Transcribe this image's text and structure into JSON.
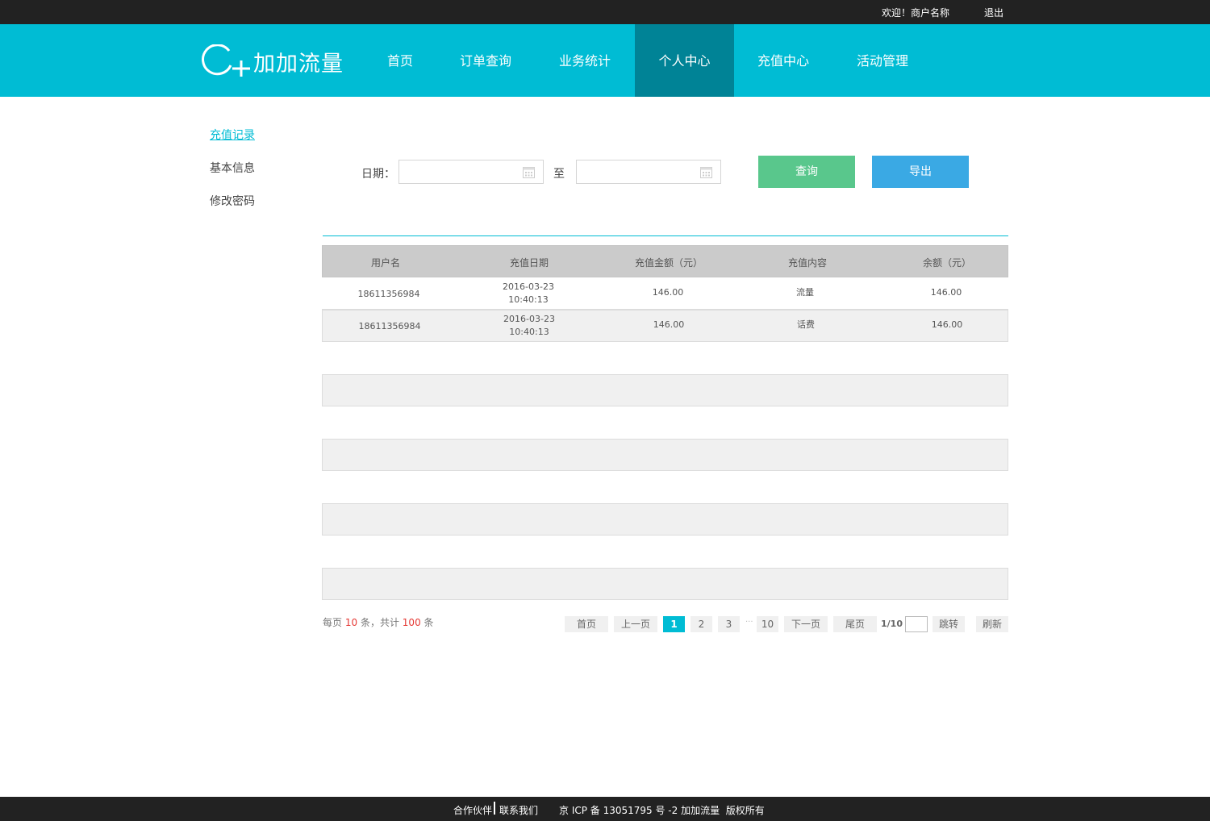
{
  "topbar": {
    "welcome": "欢迎！商户名称",
    "logout": "退出"
  },
  "header": {
    "logo_text": "加加流量",
    "nav": [
      {
        "label": "首页",
        "active": false
      },
      {
        "label": "订单查询",
        "active": false
      },
      {
        "label": "业务统计",
        "active": false
      },
      {
        "label": "个人中心",
        "active": true
      },
      {
        "label": "充值中心",
        "active": false
      },
      {
        "label": "活动管理",
        "active": false
      }
    ]
  },
  "sidebar": {
    "items": [
      {
        "label": "充值记录",
        "active": true
      },
      {
        "label": "基本信息",
        "active": false
      },
      {
        "label": "修改密码",
        "active": false
      }
    ]
  },
  "filter": {
    "date_label": "日期：",
    "to_label": "至",
    "start_value": "",
    "end_value": "",
    "query_button": "查询",
    "export_button": "导出"
  },
  "table": {
    "headers": [
      "用户名",
      "充值日期",
      "充值金额（元）",
      "充值内容",
      "余额（元）"
    ],
    "rows": [
      {
        "user": "18611356984",
        "date": "2016-03-23",
        "time": "10:40:13",
        "amount": "146.00",
        "content": "流量",
        "balance": "146.00"
      },
      {
        "user": "18611356984",
        "date": "2016-03-23",
        "time": "10:40:13",
        "amount": "146.00",
        "content": "话费",
        "balance": "146.00"
      }
    ]
  },
  "pagination": {
    "per_page_prefix": "每页",
    "per_page": "10",
    "per_page_mid": "条，共计",
    "total": "100",
    "suffix": "条",
    "first": "首页",
    "prev": "上一页",
    "pages": [
      "1",
      "2",
      "3"
    ],
    "dots": "···",
    "last_page": "10",
    "next": "下一页",
    "last": "尾页",
    "page_status": "1/10",
    "jump_value": "",
    "jump": "跳转",
    "refresh": "刷新"
  },
  "footer": {
    "partners": "合作伙伴",
    "contact": "联系我们",
    "icp": "京 ICP 备 13051795 号 -2 加加流量  版权所有"
  },
  "colors": {
    "brand": "#00bcd4",
    "nav_active": "#008396",
    "query_btn": "#59c78c",
    "export_btn": "#3aa9e4",
    "highlight": "#e53935"
  }
}
